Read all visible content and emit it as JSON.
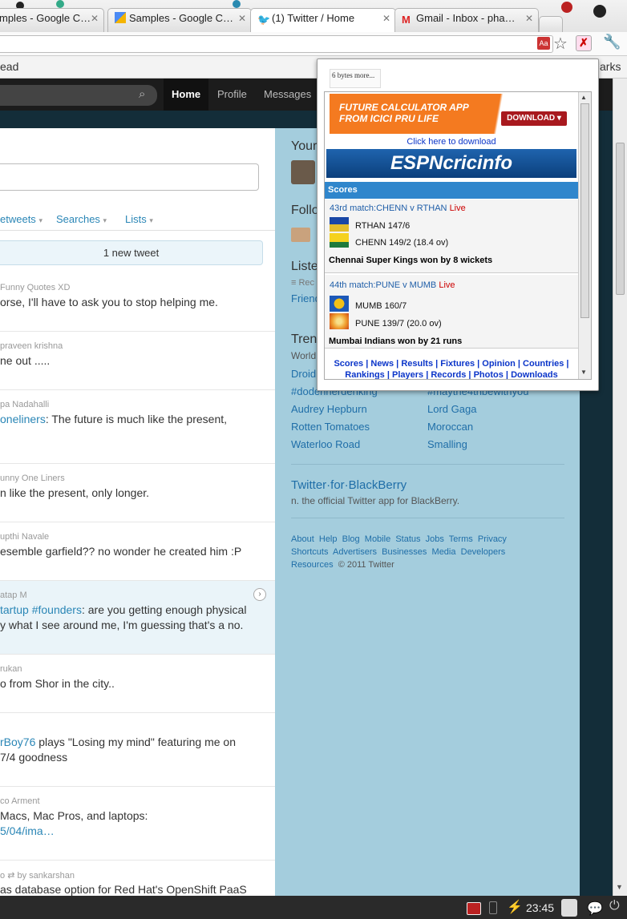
{
  "tabs": [
    {
      "label": "mples - Google C…",
      "icon": "google-sites-icon"
    },
    {
      "label": "Samples - Google C…",
      "icon": "google-sites-icon"
    },
    {
      "label": "(1) Twitter / Home",
      "icon": "twitter-bird-icon"
    },
    {
      "label": "Gmail - Inbox - pha…",
      "icon": "gmail-icon"
    }
  ],
  "bookmarks": {
    "left_fragment": "ead",
    "right_fragment": "arks"
  },
  "twitter_nav": {
    "home": "Home",
    "profile": "Profile",
    "messages": "Messages"
  },
  "timeline": {
    "tabs": [
      "etweets",
      "Searches",
      "Lists"
    ],
    "new_tweet": "1 new tweet",
    "tweets": [
      {
        "name": "Funny Quotes XD",
        "text": "orse, I'll have to ask you to stop helping me."
      },
      {
        "name": "praveen krishna",
        "text": "ne out ....."
      },
      {
        "name": "pa Nadahalli",
        "link": "oneliners",
        "text": ": The future is much like the present,"
      },
      {
        "name": "unny One Liners",
        "text": "n like the present, only longer."
      },
      {
        "name": "upthi Navale",
        "text": "esemble garfield?? no wonder he created him :P"
      },
      {
        "name": "atap M",
        "link": "tartup #founders",
        "text": ": are you getting enough physical",
        "text2": "y what I see around me, I'm guessing that's a no."
      },
      {
        "name": "rukan",
        "text": "o from Shor in the city.."
      },
      {
        "link": "rBoy76",
        "text": " plays \"Losing my mind\" featuring me on",
        "text2": " 7/4 goodness"
      },
      {
        "name": "co Arment",
        "text": "Macs, Mac Pros, and laptops:",
        "link2": "5/04/ima…"
      },
      {
        "name": "o",
        "retweet": "by sankarshan",
        "text": "as database option for Red Hat's OpenShift PaaS"
      }
    ]
  },
  "sidebar": {
    "your": "Your",
    "follo": "Follo",
    "lists": "Liste",
    "lists_sub": "Rec",
    "friends": "Friend",
    "trends": "Tren",
    "world": "World",
    "droid": "Droid",
    "trends_left": [
      "#dodennerdenking",
      "Audrey Hepburn",
      "Rotten Tomatoes",
      "Waterloo Road"
    ],
    "trends_right": [
      "#maythe4thbewithyou",
      "Lord Gaga",
      "Moroccan",
      "Smalling"
    ],
    "bb_title": "Twitter·for·BlackBerry",
    "bb_sub": "n. the official Twitter app for BlackBerry.",
    "footer_row1": [
      "About",
      "Help",
      "Blog",
      "Mobile",
      "Status",
      "Jobs",
      "Terms",
      "Privacy"
    ],
    "footer_row2": [
      "Shortcuts",
      "Advertisers",
      "Businesses",
      "Media",
      "Developers"
    ],
    "footer_row3": "Resources",
    "copyright": "© 2011 Twitter"
  },
  "popup": {
    "header": "6 bytes more...",
    "ad_line1": "FUTURE CALCULATOR APP",
    "ad_line2": "FROM ICICI PRU LIFE",
    "ad_button": "DOWNLOAD",
    "ad_link": "Click here to download",
    "brand": "ESPNcricinfo",
    "scores_title": "Scores",
    "match1": {
      "title": "43rd match:CHENN v RTHAN",
      "live": "Live",
      "team1": "RTHAN 147/6",
      "team2": "CHENN 149/2 (18.4 ov)",
      "result": "Chennai Super Kings won by 8 wickets"
    },
    "match2": {
      "title": "44th match:PUNE v MUMB",
      "live": "Live",
      "team1": "MUMB 160/7",
      "team2": "PUNE 139/7 (20.0 ov)",
      "result": "Mumbai Indians won by 21 runs"
    },
    "links_row1": [
      "Scores",
      "News",
      "Results",
      "Fixtures",
      "Opinion",
      "Countries"
    ],
    "links_row2": [
      "Rankings",
      "Players",
      "Records",
      "Photos",
      "Downloads"
    ]
  },
  "taskbar": {
    "time": "23:45"
  },
  "colors": {
    "twitter_link": "#2a86b6",
    "sidebar_bg": "#a4cddd",
    "cricinfo_blue": "#0b57a3",
    "live_red": "#cc0000"
  }
}
